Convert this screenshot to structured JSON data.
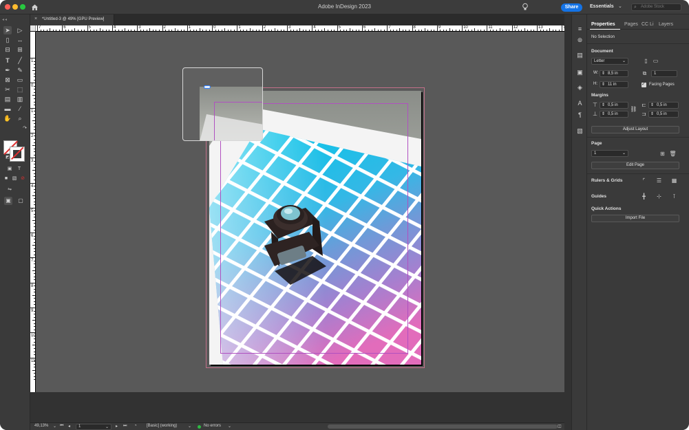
{
  "titlebar": {
    "app_title": "Adobe InDesign 2023",
    "share_label": "Share",
    "workspace_label": "Essentials",
    "workspace_chevron": "⌄",
    "stock_placeholder": "Adobe Stock"
  },
  "document_tab": {
    "close_glyph": "×",
    "name": "*Untitled-3 @ 49% [GPU Preview]"
  },
  "ruler_horizontal_labels": [
    "7",
    "6",
    "5",
    "4",
    "3",
    "2",
    "1",
    "0",
    "1",
    "2",
    "3",
    "4",
    "5",
    "6",
    "7",
    "8",
    "9",
    "10",
    "11",
    "12",
    "13",
    "14"
  ],
  "ruler_vertical_labels": [
    "1",
    "0",
    "1",
    "2",
    "3",
    "4",
    "5",
    "6",
    "7",
    "8",
    "9",
    "10",
    "11"
  ],
  "status_bar": {
    "zoom": "49,13%",
    "page": "1",
    "preflight_profile": "[Basic] (working)",
    "errors": "No errors"
  },
  "properties": {
    "tabs": [
      "Properties",
      "Pages",
      "CC Li",
      "Layers"
    ],
    "selection": "No Selection",
    "document_heading": "Document",
    "page_size": "Letter",
    "width_label": "W:",
    "width_value": "8,5 in",
    "height_label": "H:",
    "height_value": "11 in",
    "pages_count": "1",
    "facing_pages_label": "Facing Pages",
    "facing_pages_checked": true,
    "margins_heading": "Margins",
    "margin_top": "0,5 in",
    "margin_bottom": "0,5 in",
    "margin_inside": "0,5 in",
    "margin_outside": "0,5 in",
    "adjust_layout": "Adjust Layout",
    "page_heading": "Page",
    "page_value": "1",
    "edit_page": "Edit Page",
    "rulers_grids_heading": "Rulers & Grids",
    "guides_heading": "Guides",
    "quick_actions_heading": "Quick Actions",
    "import_file": "Import File"
  },
  "colors": {
    "accent": "#1473e6",
    "margin_guide": "#b050c0",
    "bleed_guide": "#c2708a",
    "pasteboard": "#595959",
    "status_ok": "#2dbb43"
  }
}
